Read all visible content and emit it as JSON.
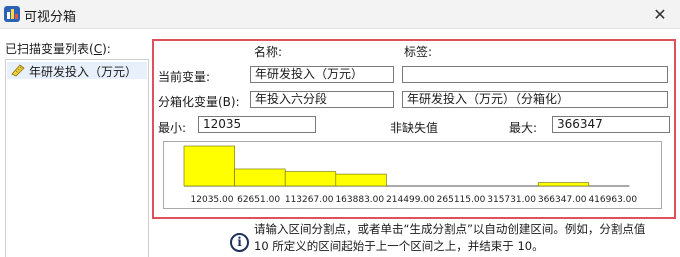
{
  "window": {
    "title": "可视分箱",
    "close_icon": "close-icon",
    "app_icon": "spss-chart-icon"
  },
  "variables": {
    "label_before": "已扫描变量列表(",
    "label_key": "C",
    "label_after": "):",
    "items": [
      {
        "label": "年研发投入（万元）",
        "icon": "ruler-scale-icon"
      }
    ]
  },
  "panel": {
    "name_header": "名称:",
    "tag_header": "标签:",
    "current_var_label": "当前变量:",
    "current_var_name": "年研发投入（万元）",
    "current_var_tag": "",
    "binned_var_label": "分箱化变量(B):",
    "binned_var_name": "年投入六分段",
    "binned_var_tag": "年研发投入（万元）（分箱化）",
    "min_label": "最小:",
    "min_value": "12035",
    "nonmissing_label": "非缺失值",
    "max_label": "最大:",
    "max_value": "366347"
  },
  "chart_data": {
    "type": "bar",
    "categories": [
      "12035.00",
      "62651.00",
      "113267.00",
      "163883.00",
      "214499.00",
      "265115.00",
      "315731.00",
      "366347.00",
      "416963.00"
    ],
    "tick_labels": [
      "12035.00",
      "62651.00",
      "113267.00",
      "163883.00",
      "214499.00",
      "265115.00",
      "315731.00",
      "366347.00",
      "416963.00"
    ],
    "values": [
      47,
      20,
      17,
      14,
      0,
      0,
      0,
      4
    ],
    "bar_color": "#ffff00",
    "xlabel": "",
    "ylabel": ""
  },
  "info": {
    "icon": "info-icon",
    "line1": "请输入区间分割点，或者单击“生成分割点”以自动创建区间。例如，分割点值",
    "line2": "10 所定义的区间起始于上一个区间之上，并结束于 10。"
  },
  "colors": {
    "highlight_border": "#e0505a",
    "bar_fill": "#ffff00",
    "selection": "#e8f0fb"
  }
}
